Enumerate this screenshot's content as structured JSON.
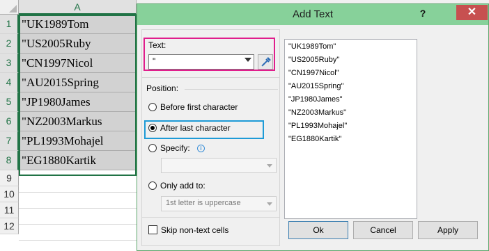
{
  "spreadsheet": {
    "column_headers": [
      "A"
    ],
    "row_numbers": [
      "1",
      "2",
      "3",
      "4",
      "5",
      "6",
      "7",
      "8",
      "9",
      "10",
      "11",
      "12"
    ],
    "cells": [
      "\"UK1989Tom",
      "\"US2005Ruby",
      "\"CN1997Nicol",
      "\"AU2015Spring",
      "\"JP1980James",
      "\"NZ2003Markus",
      "\"PL1993Mohajel",
      "\"EG1880Kartik"
    ]
  },
  "dialog": {
    "title": "Add Text",
    "help_label": "?",
    "close_label": "✕",
    "text_label": "Text:",
    "text_value": "\"",
    "position_label": "Position:",
    "options": {
      "before_first": "Before first character",
      "after_last": "After last character",
      "specify": "Specify:",
      "only_add_to": "Only add to:"
    },
    "selected_option": "after_last",
    "only_add_to_value": "1st letter is uppercase",
    "skip_non_text": "Skip non-text cells",
    "skip_non_text_checked": false,
    "preview_lines": [
      "\"UK1989Tom\"",
      "\"US2005Ruby\"",
      "\"CN1997Nicol\"",
      "\"AU2015Spring\"",
      "\"JP1980James\"",
      "\"NZ2003Markus\"",
      "\"PL1993Mohajel\"",
      "\"EG1880Kartik\""
    ],
    "buttons": {
      "ok": "Ok",
      "cancel": "Cancel",
      "apply": "Apply"
    }
  },
  "colors": {
    "titlebar": "#87d19a",
    "close_button": "#c75050",
    "text_highlight": "#e01e8c",
    "option_highlight": "#1e9bd7",
    "selection_border": "#217346"
  }
}
